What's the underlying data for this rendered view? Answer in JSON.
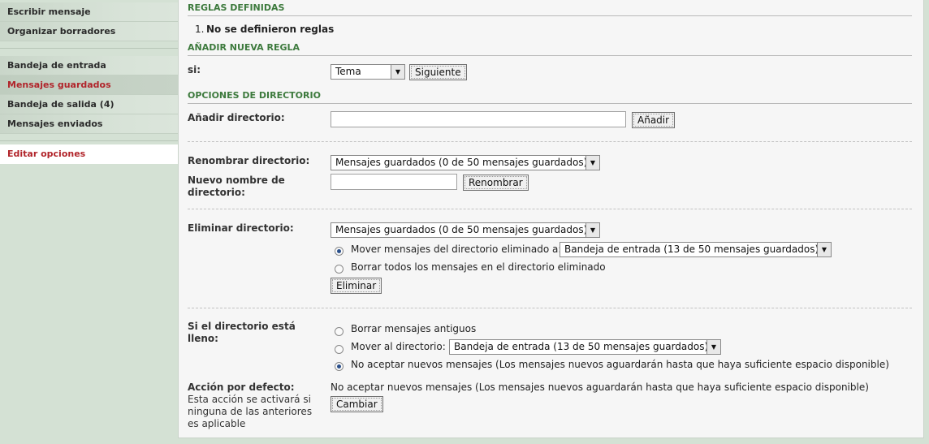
{
  "sidebar": {
    "group1": [
      "Escribir mensaje",
      "Organizar borradores"
    ],
    "group2": [
      "Bandeja de entrada",
      "Mensajes guardados",
      "Bandeja de salida (4)",
      "Mensajes enviados"
    ],
    "group3": [
      "Editar opciones"
    ]
  },
  "rules": {
    "defined_heading": "REGLAS DEFINIDAS",
    "no_rules_number": "1.",
    "no_rules": "No se definieron reglas",
    "add_heading": "AÑADIR NUEVA REGLA",
    "if_label": "si:",
    "if_select": "Tema",
    "next_button": "Siguiente"
  },
  "dir_options": {
    "heading": "OPCIONES DE DIRECTORIO",
    "add_label": "Añadir directorio:",
    "add_button": "Añadir",
    "rename_label": "Renombrar directorio:",
    "rename_select": "Mensajes guardados (0 de 50 mensajes guardados)",
    "new_name_label": "Nuevo nombre de directorio:",
    "rename_button": "Renombrar",
    "delete_label": "Eliminar directorio:",
    "delete_select": "Mensajes guardados (0 de 50 mensajes guardados)",
    "move_on_delete": "Mover mensajes del directorio eliminado a:",
    "move_on_delete_select": "Bandeja de entrada (13 de 50 mensajes guardados)",
    "delete_all": "Borrar todos los mensajes en el directorio eliminado",
    "delete_button": "Eliminar",
    "full_label": "Si el directorio está lleno:",
    "full_opt1": "Borrar mensajes antiguos",
    "full_opt2": "Mover al directorio:",
    "full_opt2_select": "Bandeja de entrada (13 de 50 mensajes guardados)",
    "full_opt3": "No aceptar nuevos mensajes (Los mensajes nuevos aguardarán hasta que haya suficiente espacio disponible)",
    "default_label": "Acción por defecto:",
    "default_note": "Esta acción se activará si ninguna de las anteriores es aplicable",
    "default_value": "No aceptar nuevos mensajes (Los mensajes nuevos aguardarán hasta que haya suficiente espacio disponible)",
    "change_button": "Cambiar"
  }
}
